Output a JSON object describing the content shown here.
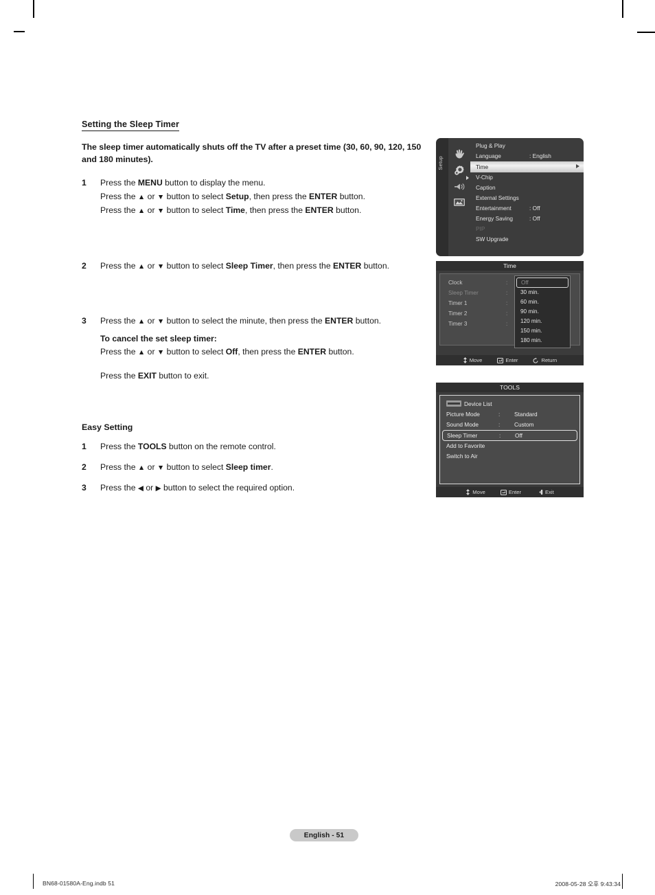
{
  "page": {
    "section_title": "Setting the Sleep Timer",
    "lead": "The sleep timer automatically shuts off the TV after a preset time (30, 60, 90, 120, 150 and 180 minutes).",
    "badge": "English - 51",
    "footer_left": "BN68-01580A-Eng.indb   51",
    "footer_right": "2008-05-28   오후 9:43:34"
  },
  "steps": {
    "s1_num": "1",
    "s1_l1_a": "Press the ",
    "s1_l1_menu": "MENU",
    "s1_l1_b": " button to display the menu.",
    "s1_l2_a": "Press the ",
    "s1_l2_up": "▲",
    "s1_l2_or": " or ",
    "s1_l2_dn": "▼",
    "s1_l2_b": " button to select ",
    "s1_l2_setup": "Setup",
    "s1_l2_c": ", then press the ",
    "s1_l2_enter": "ENTER",
    "s1_l2_d": " button.",
    "s1_l3_b": " button to select ",
    "s1_l3_time": "Time",
    "s1_l3_c": ", then press the ",
    "s1_l3_enter": "ENTER",
    "s1_l3_d": " button.",
    "s2_num": "2",
    "s2_a": "Press the ",
    "s2_b": " button to select ",
    "s2_sleep": "Sleep Timer",
    "s2_c": ", then press the ",
    "s2_enter": "ENTER",
    "s2_d": " button.",
    "s3_num": "3",
    "s3_a": "Press the ",
    "s3_b": " button to select the minute, then press the ",
    "s3_enter": "ENTER",
    "s3_c": " button.",
    "s3_cancel_head": "To cancel the set sleep timer:",
    "s3_cancel_a": "Press the ",
    "s3_cancel_b": " button to select ",
    "s3_off": "Off",
    "s3_cancel_c": ", then press the ",
    "s3_cancel_enter": "ENTER",
    "s3_cancel_d": " button.",
    "s3_exit_a": "Press the ",
    "s3_exit_btn": "EXIT",
    "s3_exit_b": " button to exit."
  },
  "easy": {
    "title": "Easy Setting",
    "e1_num": "1",
    "e1_a": "Press the ",
    "e1_tools": "TOOLS",
    "e1_b": " button on the remote control.",
    "e2_num": "2",
    "e2_a": "Press the ",
    "e2_up": "▲",
    "e2_or": " or ",
    "e2_dn": "▼",
    "e2_b": " button to select ",
    "e2_sleep": "Sleep timer",
    "e2_c": ".",
    "e3_num": "3",
    "e3_a": "Press the ",
    "e3_left": "◀",
    "e3_or": " or ",
    "e3_right": "▶",
    "e3_b": " button to select the required option."
  },
  "osd_setup": {
    "rail_label": "Setup",
    "rows": [
      {
        "label": "Plug & Play",
        "value": "",
        "state": "normal"
      },
      {
        "label": "Language",
        "value": ": English",
        "state": "normal"
      },
      {
        "label": "Time",
        "value": "",
        "state": "selected"
      },
      {
        "label": "V-Chip",
        "value": "",
        "state": "normal"
      },
      {
        "label": "Caption",
        "value": "",
        "state": "normal"
      },
      {
        "label": "External Settings",
        "value": "",
        "state": "normal"
      },
      {
        "label": "Entertainment",
        "value": ": Off",
        "state": "normal"
      },
      {
        "label": "Energy Saving",
        "value": ": Off",
        "state": "normal"
      },
      {
        "label": "PIP",
        "value": "",
        "state": "dim"
      },
      {
        "label": "SW Upgrade",
        "value": "",
        "state": "normal"
      }
    ],
    "icons": [
      "input-hand-icon",
      "gear-setup-icon",
      "sound-icon",
      "picture-icon"
    ]
  },
  "osd_time": {
    "title": "Time",
    "items": [
      {
        "label": "Clock",
        "state": "normal"
      },
      {
        "label": "Sleep Timer",
        "state": "dim"
      },
      {
        "label": "Timer 1",
        "state": "normal"
      },
      {
        "label": "Timer 2",
        "state": "normal"
      },
      {
        "label": "Timer 3",
        "state": "normal"
      }
    ],
    "dropdown": [
      {
        "label": "Off",
        "state": "selected"
      },
      {
        "label": "30 min.",
        "state": "normal"
      },
      {
        "label": "60 min.",
        "state": "normal"
      },
      {
        "label": "90 min.",
        "state": "normal"
      },
      {
        "label": "120 min.",
        "state": "normal"
      },
      {
        "label": "150 min.",
        "state": "normal"
      },
      {
        "label": "180 min.",
        "state": "normal"
      }
    ],
    "footer": {
      "move": "Move",
      "enter": "Enter",
      "return": "Return"
    }
  },
  "osd_tools": {
    "title": "TOOLS",
    "rows": [
      {
        "label": "Device List",
        "colon": "",
        "value": "",
        "state": "icon"
      },
      {
        "label": "Picture Mode",
        "colon": ":",
        "value": "Standard",
        "state": "normal"
      },
      {
        "label": "Sound Mode",
        "colon": ":",
        "value": "Custom",
        "state": "normal"
      },
      {
        "label": "Sleep Timer",
        "colon": ":",
        "value": "Off",
        "state": "selected"
      },
      {
        "label": "Add to Favorite",
        "colon": "",
        "value": "",
        "state": "normal"
      },
      {
        "label": "Switch to Air",
        "colon": "",
        "value": "",
        "state": "normal"
      }
    ],
    "footer": {
      "move": "Move",
      "enter": "Enter",
      "exit": "Exit"
    }
  }
}
